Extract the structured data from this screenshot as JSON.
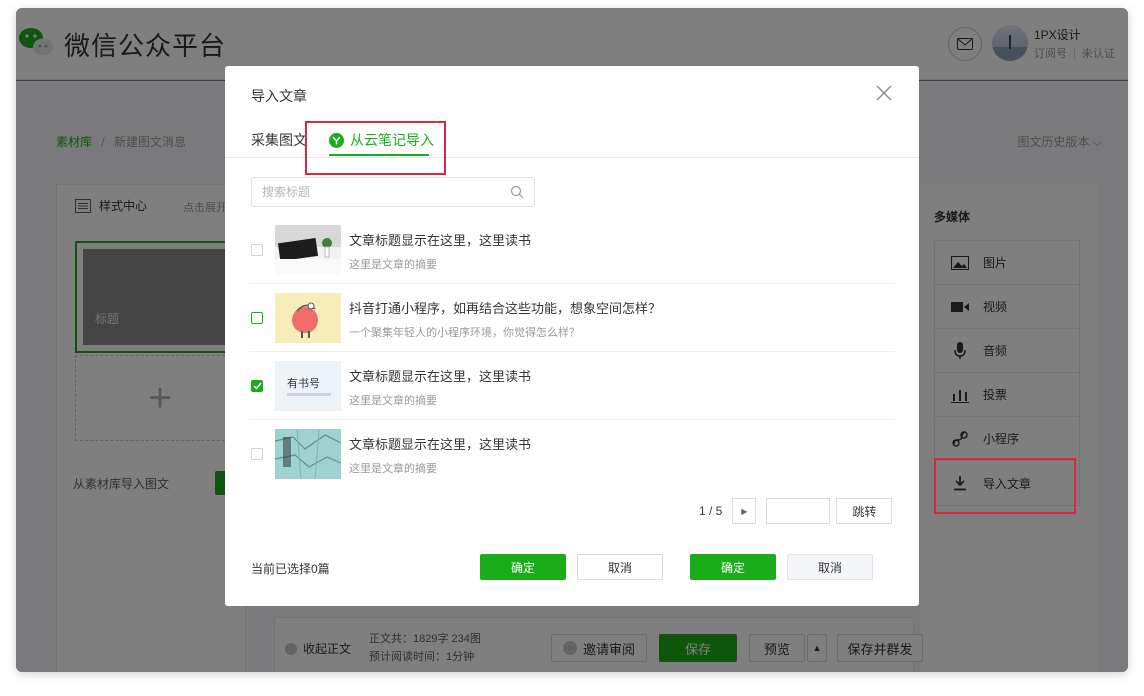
{
  "header": {
    "app_title": "微信公众平台",
    "account_name": "1PX设计",
    "account_type": "订阅号",
    "account_status": "未认证"
  },
  "breadcrumb": {
    "root": "素材库",
    "separator": "/",
    "current": "新建图文消息"
  },
  "history_label": "图文历史版本",
  "left_panel": {
    "style_center": "样式中心",
    "expand_hint": "点击展开",
    "cover_title": "标题",
    "add_symbol": "+",
    "import_from_library": "从素材库导入图文"
  },
  "media_panel": {
    "title": "多媒体",
    "items": [
      {
        "label": "图片",
        "icon": "image-icon"
      },
      {
        "label": "视频",
        "icon": "video-icon"
      },
      {
        "label": "音频",
        "icon": "microphone-icon"
      },
      {
        "label": "投票",
        "icon": "bar-chart-icon"
      },
      {
        "label": "小程序",
        "icon": "mini-program-icon"
      },
      {
        "label": "导入文章",
        "icon": "download-icon"
      }
    ]
  },
  "bottom_bar": {
    "collapse": "收起正文",
    "word_count": "正文共：1829字 234图",
    "read_time": "预计阅读时间：1分钟",
    "review": "邀请审阅",
    "save": "保存",
    "preview": "预览",
    "save_and_send": "保存并群发"
  },
  "modal": {
    "title": "导入文章",
    "tabs": [
      {
        "label": "采集图文",
        "active": false
      },
      {
        "label": "从云笔记导入",
        "active": true
      }
    ],
    "search_placeholder": "搜索标题",
    "articles": [
      {
        "title": "文章标题显示在这里，这里读书",
        "summary": "这里是文章的摘要",
        "state": "unchecked"
      },
      {
        "title": "抖音打通小程序，如再结合这些功能，想象空间怎样？",
        "summary": "一个聚集年轻人的小程序环境，你觉得怎么样？",
        "state": "hover"
      },
      {
        "title": "文章标题显示在这里，这里读书",
        "summary": "这里是文章的摘要",
        "state": "checked"
      },
      {
        "title": "文章标题显示在这里，这里读书",
        "summary": "这里是文章的摘要",
        "state": "unchecked"
      }
    ],
    "thumb3_text": "有书号",
    "pager": {
      "current": "1 / 5",
      "jump_value": "",
      "jump": "跳转"
    },
    "selected_text": "当前已选择0篇",
    "confirm": "确定",
    "cancel": "取消",
    "confirm_alt": "确定",
    "cancel_alt": "取消"
  },
  "colors": {
    "brand_green": "#1aad19",
    "highlight_red": "#d9273f"
  }
}
